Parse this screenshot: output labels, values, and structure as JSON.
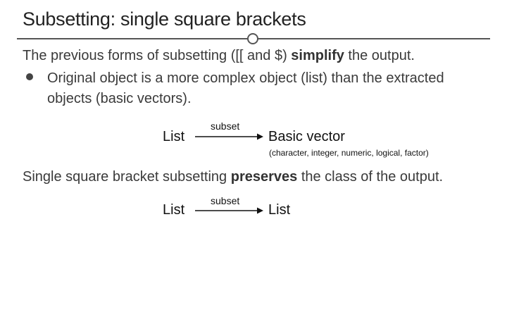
{
  "title": "Subsetting: single square brackets",
  "intro": {
    "before": "The previous forms of subsetting ([[ and $) ",
    "bold": "simplify",
    "after": " the output."
  },
  "bullet": "Original object is a more complex object (list) than the extracted objects (basic vectors).",
  "diagram1": {
    "from": "List",
    "arrow_label": "subset",
    "to": "Basic vector",
    "note": "(character, integer, numeric, logical, factor)"
  },
  "second": {
    "before": "Single square bracket subsetting ",
    "bold": "preserves",
    "after": " the class of the output."
  },
  "diagram2": {
    "from": "List",
    "arrow_label": "subset",
    "to": "List"
  }
}
